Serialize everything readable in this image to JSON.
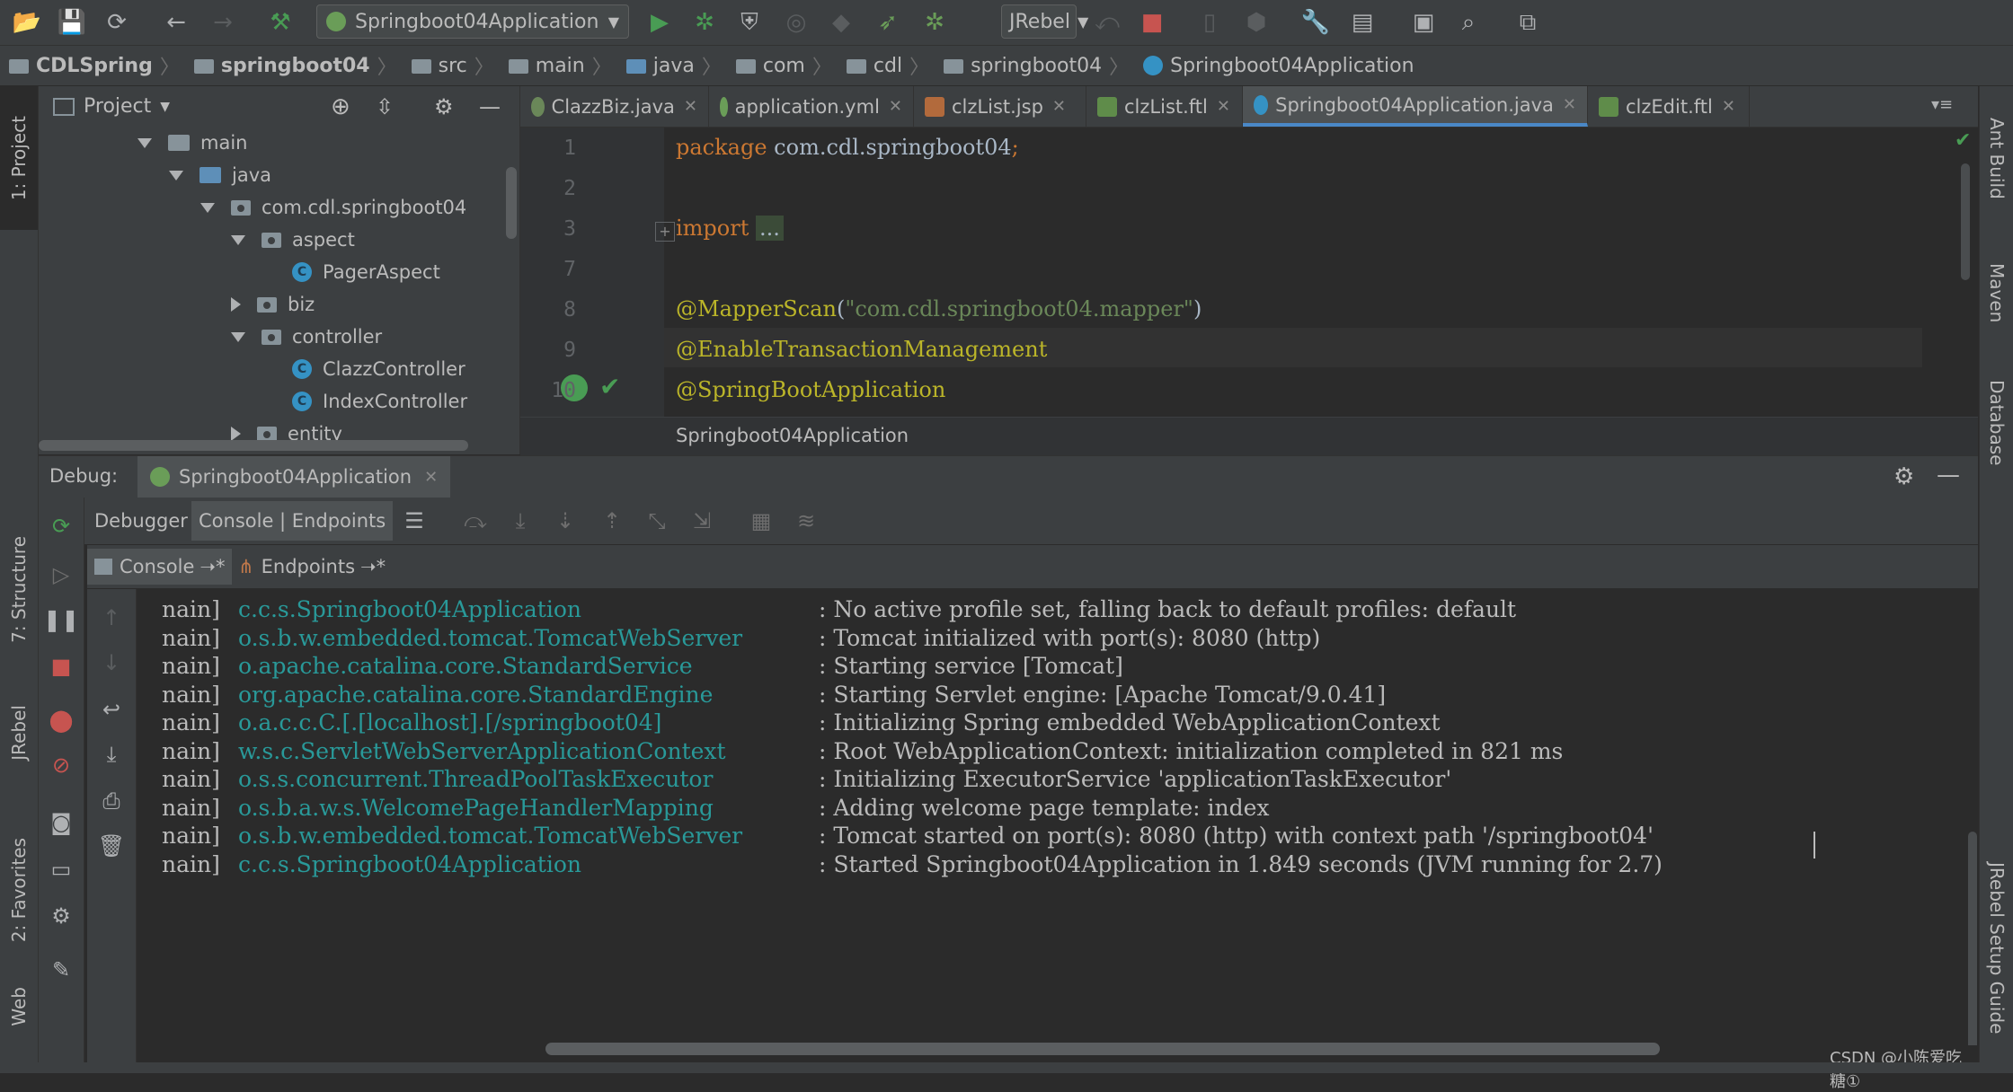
{
  "toolbar": {
    "run_config": "Springboot04Application",
    "jrebel": "JRebel"
  },
  "breadcrumb": [
    "CDLSpring",
    "springboot04",
    "src",
    "main",
    "java",
    "com",
    "cdl",
    "springboot04",
    "Springboot04Application"
  ],
  "left_stripe": {
    "project": "1: Project",
    "structure": "7: Structure",
    "jrebel": "JRebel",
    "favorites": "2: Favorites",
    "web": "Web"
  },
  "right_stripe": {
    "ant": "Ant Build",
    "maven": "Maven",
    "database": "Database",
    "jrebel_setup": "JRebel Setup Guide"
  },
  "project_panel": {
    "title": "Project",
    "tree": [
      {
        "label": "main",
        "type": "folder",
        "state": "expanded"
      },
      {
        "label": "java",
        "type": "folder-blue",
        "state": "expanded"
      },
      {
        "label": "com.cdl.springboot04",
        "type": "package",
        "state": "expanded"
      },
      {
        "label": "aspect",
        "type": "package",
        "state": "expanded"
      },
      {
        "label": "PagerAspect",
        "type": "class",
        "state": "leaf"
      },
      {
        "label": "biz",
        "type": "package",
        "state": "collapsed"
      },
      {
        "label": "controller",
        "type": "package",
        "state": "expanded"
      },
      {
        "label": "ClazzController",
        "type": "class",
        "state": "leaf"
      },
      {
        "label": "IndexController",
        "type": "class",
        "state": "leaf"
      },
      {
        "label": "entity",
        "type": "package",
        "state": "collapsed"
      }
    ]
  },
  "editor_tabs": [
    {
      "label": "ClazzBiz.java",
      "active": false
    },
    {
      "label": "application.yml",
      "active": false
    },
    {
      "label": "clzList.jsp",
      "active": false
    },
    {
      "label": "clzList.ftl",
      "active": false
    },
    {
      "label": "Springboot04Application.java",
      "active": true
    },
    {
      "label": "clzEdit.ftl",
      "active": false
    }
  ],
  "editor": {
    "lines": [
      {
        "num": "1",
        "parts": [
          {
            "t": "package ",
            "c": "#cc7832"
          },
          {
            "t": "com.cdl.springboot04",
            "c": "#a9b7c6"
          },
          {
            "t": ";",
            "c": "#cc7832"
          }
        ]
      },
      {
        "num": "2",
        "parts": []
      },
      {
        "num": "3",
        "parts": [
          {
            "t": "import ",
            "c": "#cc7832"
          },
          {
            "t": "...",
            "c": "#a9b7c6"
          }
        ]
      },
      {
        "num": "7",
        "parts": []
      },
      {
        "num": "8",
        "parts": [
          {
            "t": "@MapperScan",
            "c": "#bbb529"
          },
          {
            "t": "(",
            "c": "#a9b7c6"
          },
          {
            "t": "\"com.cdl.springboot04.mapper\"",
            "c": "#6a8759"
          },
          {
            "t": ")",
            "c": "#a9b7c6"
          }
        ]
      },
      {
        "num": "9",
        "parts": [
          {
            "t": "@EnableTransactionManagement",
            "c": "#bbb529"
          }
        ]
      },
      {
        "num": "10",
        "parts": [
          {
            "t": "@SpringBootApplication",
            "c": "#bbb529"
          }
        ]
      }
    ],
    "breadcrumb": "Springboot04Application"
  },
  "debug": {
    "label": "Debug:",
    "session": "Springboot04Application",
    "tabs": [
      "Debugger",
      "Console | Endpoints"
    ],
    "subtabs": [
      "Console",
      "Endpoints"
    ]
  },
  "console": [
    {
      "thread": "nain]",
      "logger": "c.c.s.Springboot04Application",
      "msg": ": No active profile set, falling back to default profiles: default"
    },
    {
      "thread": "nain]",
      "logger": "o.s.b.w.embedded.tomcat.TomcatWebServer",
      "msg": ": Tomcat initialized with port(s): 8080 (http)"
    },
    {
      "thread": "nain]",
      "logger": "o.apache.catalina.core.StandardService",
      "msg": ": Starting service [Tomcat]"
    },
    {
      "thread": "nain]",
      "logger": "org.apache.catalina.core.StandardEngine",
      "msg": ": Starting Servlet engine: [Apache Tomcat/9.0.41]"
    },
    {
      "thread": "nain]",
      "logger": "o.a.c.c.C.[.[localhost].[/springboot04]",
      "msg": ": Initializing Spring embedded WebApplicationContext"
    },
    {
      "thread": "nain]",
      "logger": "w.s.c.ServletWebServerApplicationContext",
      "msg": ": Root WebApplicationContext: initialization completed in 821 ms"
    },
    {
      "thread": "nain]",
      "logger": "o.s.s.concurrent.ThreadPoolTaskExecutor",
      "msg": ": Initializing ExecutorService 'applicationTaskExecutor'"
    },
    {
      "thread": "nain]",
      "logger": "o.s.b.a.w.s.WelcomePageHandlerMapping",
      "msg": ": Adding welcome page template: index"
    },
    {
      "thread": "nain]",
      "logger": "o.s.b.w.embedded.tomcat.TomcatWebServer",
      "msg": ": Tomcat started on port(s): 8080 (http) with context path '/springboot04'"
    },
    {
      "thread": "nain]",
      "logger": "c.c.s.Springboot04Application",
      "msg": ": Started Springboot04Application in 1.849 seconds (JVM running for 2.7)"
    }
  ],
  "watermark": "CSDN @小陈爱吃糖①"
}
